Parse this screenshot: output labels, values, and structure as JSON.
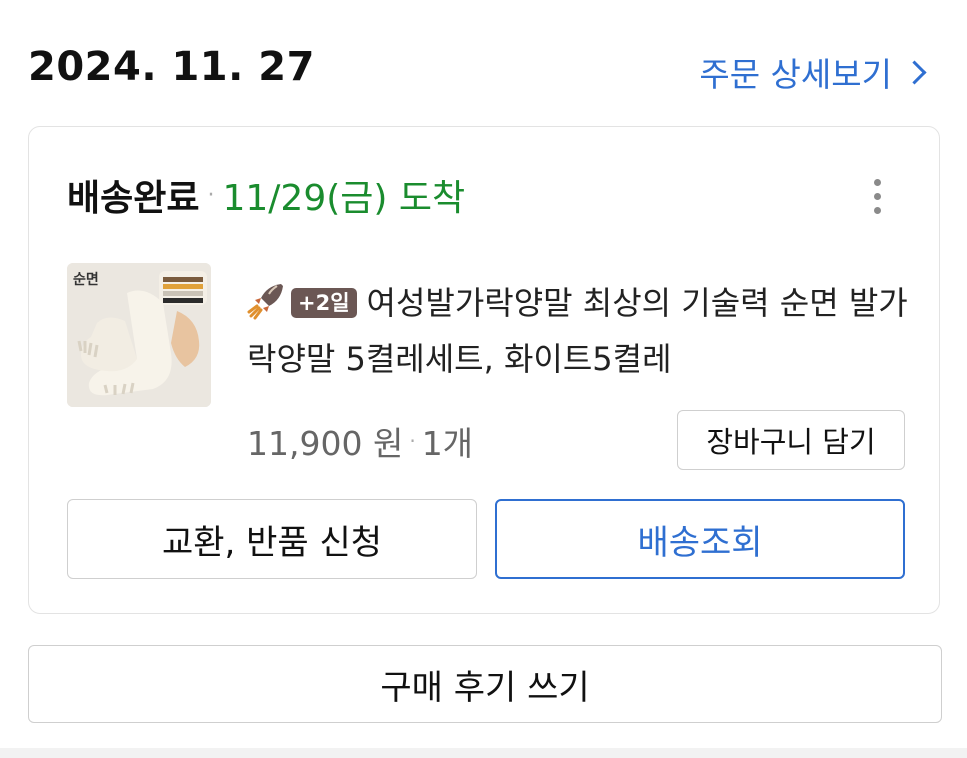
{
  "order": {
    "date": "2024. 11. 27",
    "detail_link_label": "주문 상세보기"
  },
  "shipment": {
    "status": "배송완료",
    "arrival": "11/29(금) 도착",
    "product": {
      "badge": "+2일",
      "title": "여성발가락양말 최상의 기술력 순면 발가락양말 5켤레세트, 화이트5켤레",
      "thumb_text": "순면",
      "price": "11,900 원",
      "quantity": "1개"
    },
    "cart_button": "장바구니 담기",
    "return_button": "교환, 반품 신청",
    "track_button": "배송조회"
  },
  "review_button": "구매 후기 쓰기",
  "icons": {
    "more": "more-vertical-icon",
    "rocket": "rocket-icon",
    "chevron": "chevron-right-icon"
  },
  "colors": {
    "accent": "#2f6fd1",
    "arrival": "#1a8c2e",
    "badge": "#6b5754"
  }
}
